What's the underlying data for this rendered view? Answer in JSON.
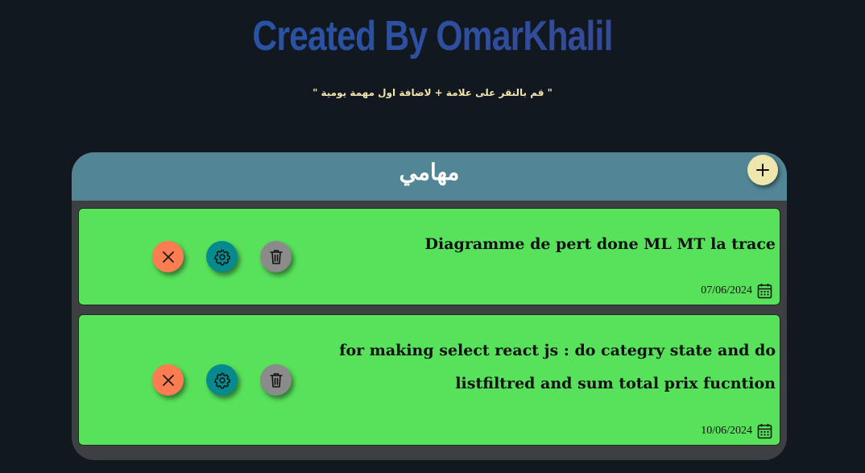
{
  "header": {
    "title": "Created By OmarKhalil",
    "hint": "\" قم بالنقر على علامة + لاضافة اول مهمة يومية \""
  },
  "panel": {
    "title": "مهامي",
    "add_label": "+"
  },
  "tasks": [
    {
      "text": "Diagramme de pert done ML MT la trace",
      "date": "07/06/2024"
    },
    {
      "text": "for making select react js : do categry state and do listfiltred and sum total prix fucntion",
      "date": "10/06/2024"
    }
  ],
  "colors": {
    "background": "#111820",
    "header_bar": "#528596",
    "panel_body": "#3d3f42",
    "task_card": "#58e15b",
    "add_button": "#efe6ad",
    "close_button": "#fd7c52",
    "settings_button": "#078a8e",
    "delete_button": "#8b8b8b",
    "hint_text": "#f1e3ad"
  },
  "icons": {
    "add": "plus-icon",
    "close": "close-icon",
    "settings": "gear-icon",
    "delete": "trash-icon",
    "date": "calendar-icon"
  }
}
